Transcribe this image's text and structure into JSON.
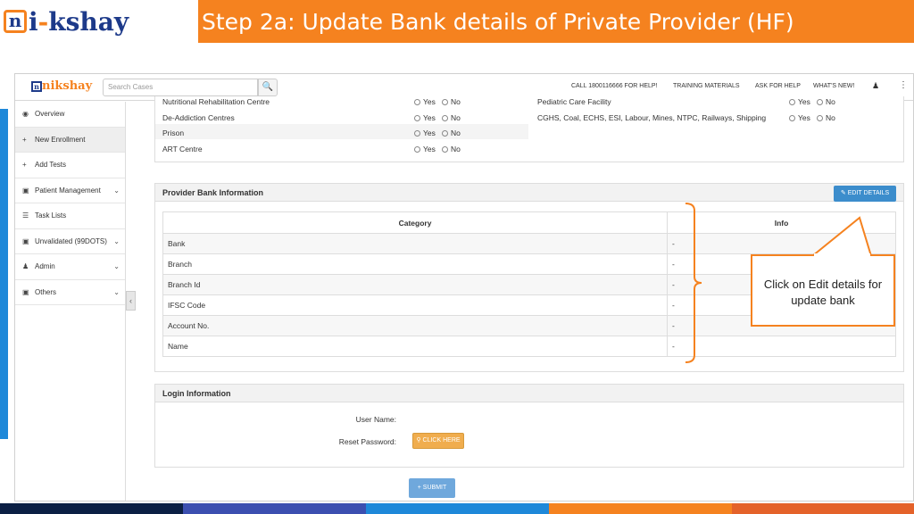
{
  "slide": {
    "logo_left": "n",
    "logo_mid": "i",
    "logo_dash": "-",
    "logo_right": "kshay",
    "title": "Step 2a: Update Bank details of Private Provider (HF)"
  },
  "colors": {
    "accent": "#f5821f",
    "blue": "#1e88d9",
    "navy": "#1d3a8a",
    "button_blue": "#3c8dcc",
    "button_orange": "#f0ad4e"
  },
  "topbar": {
    "logo": "nikshay",
    "search_placeholder": "Search Cases",
    "links": [
      "CALL 1800116666 FOR HELP!",
      "TRAINING MATERIALS",
      "ASK FOR HELP",
      "WHAT'S NEW!"
    ]
  },
  "sidebar": {
    "items": [
      {
        "label": "Overview",
        "icon": "dashboard-icon"
      },
      {
        "label": "New Enrollment",
        "icon": "plus-icon"
      },
      {
        "label": "Add Tests",
        "icon": "plus-icon"
      },
      {
        "label": "Patient Management",
        "icon": "briefcase-icon"
      },
      {
        "label": "Task Lists",
        "icon": "list-icon"
      },
      {
        "label": "Unvalidated (99DOTS)",
        "icon": "briefcase-icon"
      },
      {
        "label": "Admin",
        "icon": "user-icon"
      },
      {
        "label": "Others",
        "icon": "briefcase-icon"
      }
    ]
  },
  "facilities": {
    "left": [
      "Nutritional Rehabilitation Centre",
      "De-Addiction Centres",
      "Prison",
      "ART Centre"
    ],
    "right": [
      "Pediatric Care Facility",
      "CGHS, Coal, ECHS, ESI, Labour, Mines, NTPC, Railways, Shipping"
    ],
    "yes": "Yes",
    "no": "No"
  },
  "bank": {
    "title": "Provider Bank Information",
    "edit_label": "EDIT DETAILS",
    "col_category": "Category",
    "col_info": "Info",
    "rows": [
      {
        "category": "Bank",
        "info": "-"
      },
      {
        "category": "Branch",
        "info": "-"
      },
      {
        "category": "Branch Id",
        "info": "-"
      },
      {
        "category": "IFSC Code",
        "info": "-"
      },
      {
        "category": "Account No.",
        "info": "-"
      },
      {
        "category": "Name",
        "info": "-"
      }
    ]
  },
  "login": {
    "title": "Login Information",
    "user_label": "User Name:",
    "reset_label": "Reset Password:",
    "click_label": "CLICK HERE"
  },
  "submit_label": "SUBMIT",
  "callout": "Click on Edit details for update bank"
}
